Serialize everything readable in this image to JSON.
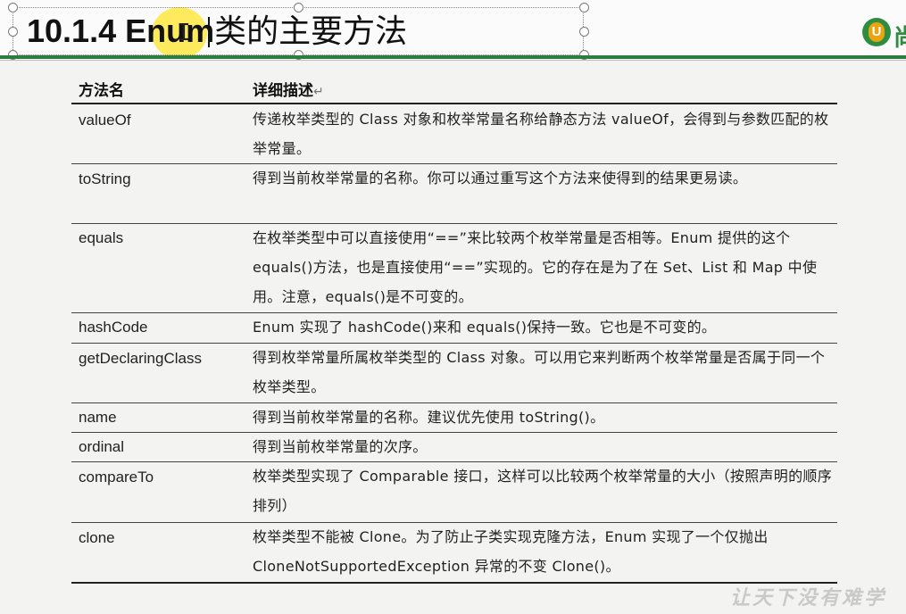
{
  "slide": {
    "title_prefix": "10.1.4 ",
    "title_code": "Enum",
    "title_suffix": "类的主要方法",
    "logo_letter": "U",
    "logo_text": "尚"
  },
  "table": {
    "header_name": "方法名",
    "header_desc": "详细描述",
    "header_mark": "↵",
    "rows": [
      {
        "name": "valueOf",
        "desc": "传递枚举类型的 Class 对象和枚举常量名称给静态方法 valueOf，会得到与参数匹配的枚举常量。"
      },
      {
        "name": "toString",
        "desc": "得到当前枚举常量的名称。你可以通过重写这个方法来使得到的结果更易读。"
      },
      {
        "name": "equals",
        "desc": "在枚举类型中可以直接使用“==”来比较两个枚举常量是否相等。Enum 提供的这个 equals()方法，也是直接使用“==”实现的。它的存在是为了在 Set、List 和 Map 中使用。注意，equals()是不可变的。"
      },
      {
        "name": "hashCode",
        "desc": "Enum 实现了 hashCode()来和 equals()保持一致。它也是不可变的。"
      },
      {
        "name": "getDeclaringClass",
        "desc": "得到枚举常量所属枚举类型的 Class 对象。可以用它来判断两个枚举常量是否属于同一个枚举类型。"
      },
      {
        "name": "name",
        "desc": "得到当前枚举常量的名称。建议优先使用 toString()。"
      },
      {
        "name": "ordinal",
        "desc": "得到当前枚举常量的次序。"
      },
      {
        "name": "compareTo",
        "desc": "枚举类型实现了 Comparable 接口，这样可以比较两个枚举常量的大小（按照声明的顺序排列）"
      },
      {
        "name": "clone",
        "desc": "枚举类型不能被 Clone。为了防止子类实现克隆方法，Enum 实现了一个仅抛出 CloneNotSupportedException 异常的不变 Clone()。"
      }
    ]
  },
  "watermark": "让天下没有难学"
}
